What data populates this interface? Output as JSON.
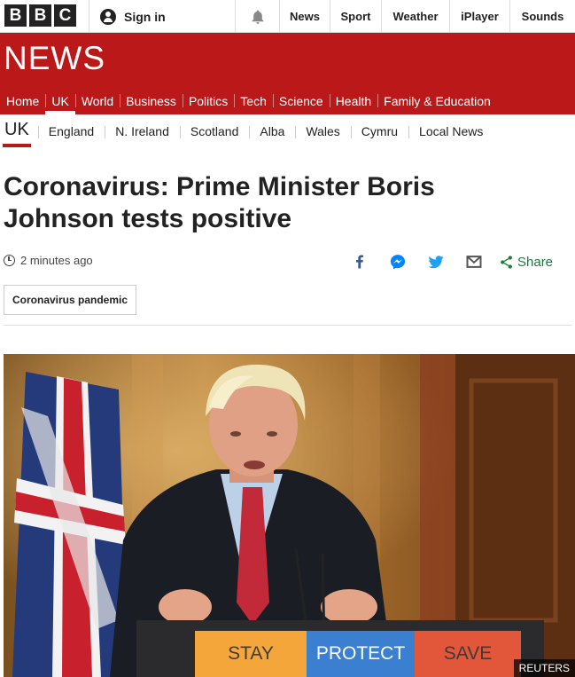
{
  "brand": {
    "letters": [
      "B",
      "B",
      "C"
    ]
  },
  "header": {
    "signin_label": "Sign in",
    "nav": [
      "News",
      "Sport",
      "Weather",
      "iPlayer",
      "Sounds"
    ]
  },
  "banner": {
    "title": "NEWS"
  },
  "sections": [
    "Home",
    "UK",
    "World",
    "Business",
    "Politics",
    "Tech",
    "Science",
    "Health",
    "Family & Education"
  ],
  "active_section": "UK",
  "subnav": {
    "current": "UK",
    "items": [
      "England",
      "N. Ireland",
      "Scotland",
      "Alba",
      "Wales",
      "Cymru",
      "Local News"
    ]
  },
  "article": {
    "headline": "Coronavirus: Prime Minister Boris Johnson tests positive",
    "timestamp": "2 minutes ago",
    "share_label": "Share",
    "tag": "Coronavirus pandemic",
    "image": {
      "credit": "REUTERS",
      "podium_words": [
        "STAY",
        "PROTECT",
        "SAVE"
      ]
    }
  },
  "colors": {
    "brand_red": "#bb1919",
    "facebook": "#3b5998",
    "messenger": "#0084ff",
    "twitter": "#1da1f2",
    "share_green": "#1c7a3c"
  },
  "icons": [
    "user-icon",
    "bell-icon",
    "clock-icon",
    "facebook-icon",
    "messenger-icon",
    "twitter-icon",
    "email-icon",
    "share-icon"
  ]
}
